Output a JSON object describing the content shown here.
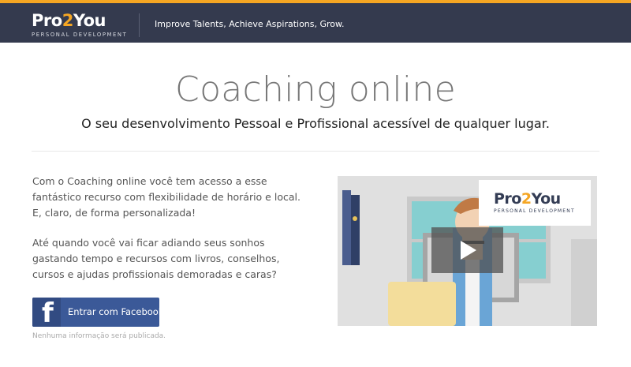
{
  "header": {
    "logo": {
      "word_part1": "Pro",
      "word_part2": "2",
      "word_part3": "You",
      "subtitle": "PERSONAL DEVELOPMENT"
    },
    "tagline": "Improve Talents,  Achieve Aspirations,  Grow."
  },
  "hero": {
    "title": "Coaching online",
    "subtitle": "O seu desenvolvimento Pessoal e Profissional acessível de qualquer lugar."
  },
  "content": {
    "paragraph1": "Com o Coaching online você tem acesso a esse fantástico recurso com flexibilidade de horário e local. E, claro, de forma personalizada!",
    "paragraph2": "Até quando você vai ficar adiando seus sonhos gastando tempo e recursos com livros, conselhos, cursos e ajudas profissionais demoradas e caras?",
    "facebook_button": {
      "icon": "facebook-icon",
      "label": "Entrar com Facebook"
    },
    "facebook_note": "Nenhuma informação será publicada."
  },
  "video": {
    "logo": {
      "word_part1": "Pro",
      "word_part2": "2",
      "word_part3": "You",
      "subtitle": "PERSONAL DEVELOPMENT"
    },
    "play_icon": "play-icon"
  },
  "colors": {
    "header_bg": "#343a4e",
    "accent": "#f5a623",
    "facebook": "#3b5998"
  }
}
